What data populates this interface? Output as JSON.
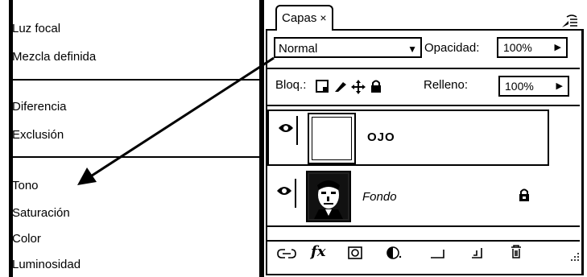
{
  "blend_modes": [
    {
      "label": "Luz focal"
    },
    {
      "label": "Mezcla definida"
    },
    {
      "label": "Diferencia"
    },
    {
      "label": "Exclusión"
    },
    {
      "label": "Tono"
    },
    {
      "label": "Saturación"
    },
    {
      "label": "Color"
    },
    {
      "label": "Luminosidad"
    }
  ],
  "panel": {
    "tab_label": "Capas",
    "tab_close": "×",
    "blend_mode": "Normal",
    "opacity_label": "Opacidad:",
    "opacity_value": "100%",
    "lock_label": "Bloq.:",
    "fill_label": "Relleno:",
    "fill_value": "100%",
    "layers": [
      {
        "name": "OJO",
        "visible": true,
        "locked": false
      },
      {
        "name": "Fondo",
        "visible": true,
        "locked": true
      }
    ]
  },
  "icons": {
    "eye": "eye-icon",
    "lock": "lock-icon",
    "link": "link-icon",
    "fx": "fx-icon",
    "mask": "mask-icon",
    "adjustment": "adjustment-icon",
    "group": "folder-icon",
    "new_layer": "new-layer-icon",
    "delete": "trash-icon"
  },
  "footer": {
    "fx_label": "fx"
  }
}
